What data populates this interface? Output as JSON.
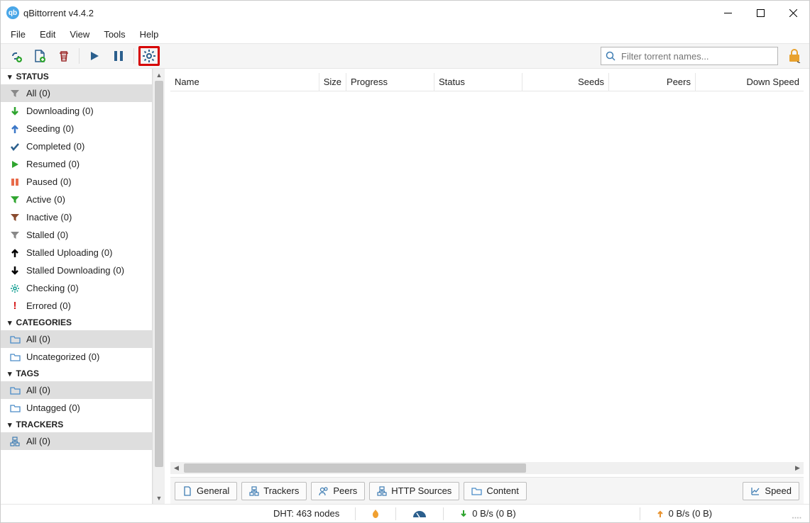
{
  "titlebar": {
    "title": "qBittorrent v4.4.2"
  },
  "menubar": {
    "file": "File",
    "edit": "Edit",
    "view": "View",
    "tools": "Tools",
    "help": "Help"
  },
  "search": {
    "placeholder": "Filter torrent names..."
  },
  "sidebar": {
    "status_header": "STATUS",
    "status_items": [
      {
        "label": "All (0)"
      },
      {
        "label": "Downloading (0)"
      },
      {
        "label": "Seeding (0)"
      },
      {
        "label": "Completed (0)"
      },
      {
        "label": "Resumed (0)"
      },
      {
        "label": "Paused (0)"
      },
      {
        "label": "Active (0)"
      },
      {
        "label": "Inactive (0)"
      },
      {
        "label": "Stalled (0)"
      },
      {
        "label": "Stalled Uploading (0)"
      },
      {
        "label": "Stalled Downloading (0)"
      },
      {
        "label": "Checking (0)"
      },
      {
        "label": "Errored (0)"
      }
    ],
    "categories_header": "CATEGORIES",
    "categories_items": [
      {
        "label": "All (0)"
      },
      {
        "label": "Uncategorized (0)"
      }
    ],
    "tags_header": "TAGS",
    "tags_items": [
      {
        "label": "All (0)"
      },
      {
        "label": "Untagged (0)"
      }
    ],
    "trackers_header": "TRACKERS",
    "trackers_items": [
      {
        "label": "All (0)"
      }
    ]
  },
  "columns": {
    "name": "Name",
    "size": "Size",
    "progress": "Progress",
    "status": "Status",
    "seeds": "Seeds",
    "peers": "Peers",
    "downspeed": "Down Speed"
  },
  "detail_tabs": {
    "general": "General",
    "trackers": "Trackers",
    "peers": "Peers",
    "http_sources": "HTTP Sources",
    "content": "Content",
    "speed": "Speed"
  },
  "statusbar": {
    "dht": "DHT: 463 nodes",
    "down": "0 B/s (0 B)",
    "up": "0 B/s (0 B)"
  }
}
